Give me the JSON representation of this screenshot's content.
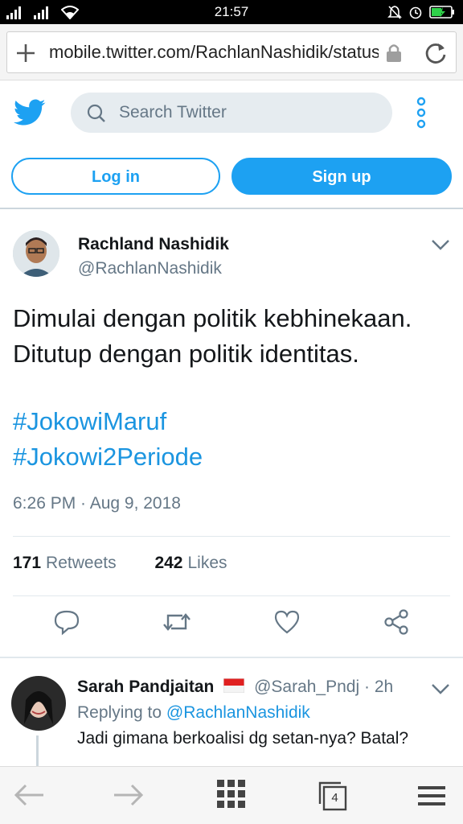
{
  "status_bar": {
    "time": "21:57"
  },
  "browser": {
    "url": "mobile.twitter.com/RachlanNashidik/status/",
    "tabs_count": "4"
  },
  "twitter_header": {
    "search_placeholder": "Search Twitter",
    "login_label": "Log in",
    "signup_label": "Sign up"
  },
  "tweet": {
    "author_name": "Rachland Nashidik",
    "author_handle": "@RachlanNashidik",
    "text_line1": "Dimulai dengan politik kebhinekaan.",
    "text_line2": "Ditutup dengan politik identitas.",
    "hashtag1": "#JokowiMaruf",
    "hashtag2": "#Jokowi2Periode",
    "timestamp": "6:26 PM · Aug 9, 2018",
    "retweets_count": "171",
    "retweets_label": "Retweets",
    "likes_count": "242",
    "likes_label": "Likes"
  },
  "reply": {
    "author_name": "Sarah Pandjaitan",
    "author_handle": "@Sarah_Pndj",
    "time_sep": "·",
    "time": "2h",
    "replying_prefix": "Replying to",
    "replying_to": "@RachlanNashidik",
    "text": "Jadi gimana berkoalisi dg setan-nya? Batal?"
  },
  "colors": {
    "twitter_blue": "#1da1f2",
    "link_blue": "#1b95e0",
    "text_gray": "#657786"
  }
}
